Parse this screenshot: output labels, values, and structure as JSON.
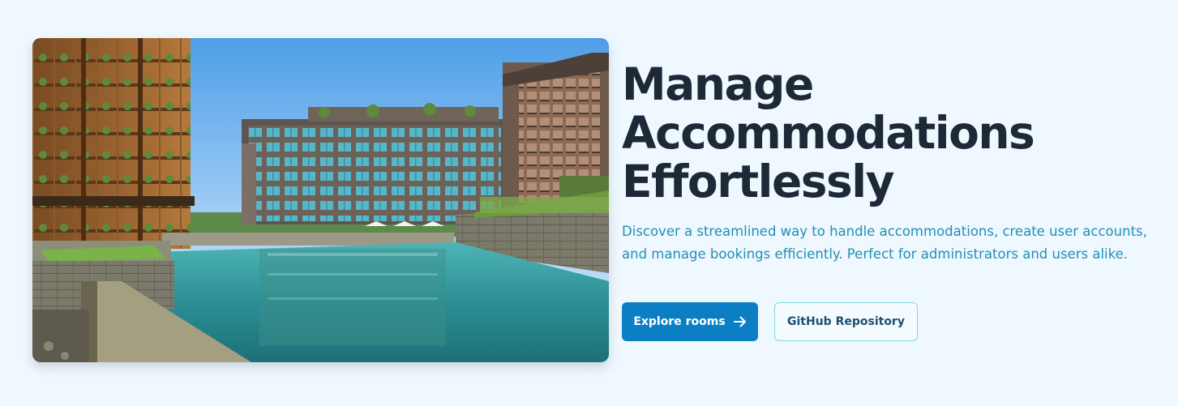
{
  "hero": {
    "image_alt": "Modern hotel buildings with balconies around a turquoise swimming pool",
    "headline_lines": [
      "Manage",
      "Accommodations",
      "Effortlessly"
    ],
    "description": "Discover a streamlined way to handle accommodations, create user accounts, and manage bookings efficiently. Perfect for administrators and users alike.",
    "primary_button": {
      "label": "Explore rooms",
      "icon": "arrow-right-icon"
    },
    "secondary_button": {
      "label": "GitHub Repository"
    }
  },
  "colors": {
    "page_background": "#f0f8ff",
    "headline": "#1e2937",
    "description": "#1f8fb5",
    "primary_button": "#0c7fc4",
    "secondary_border": "#7fd6de"
  }
}
